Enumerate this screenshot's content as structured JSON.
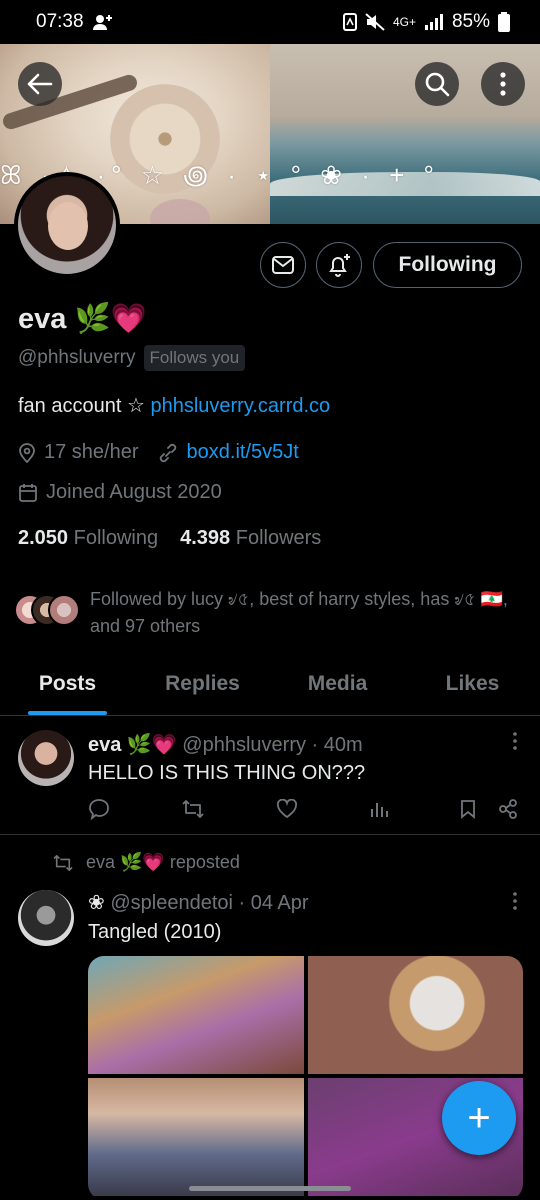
{
  "status_bar": {
    "time": "07:38",
    "network": "4G+",
    "battery": "85%"
  },
  "header": {
    "back_icon": "back-arrow-icon",
    "search_icon": "search-icon",
    "more_icon": "more-vertical-icon"
  },
  "banner": {
    "decoration": "ꕤ ·✧ ·° ☆ ꩜ · ⋆ ° ❀ · + °"
  },
  "profile": {
    "name": "eva 🌿💗",
    "handle": "@phhsluverry",
    "follows_you": "Follows you",
    "following_button": "Following",
    "bio_text": "fan account ☆ ",
    "bio_link": "phhsluverry.carrd.co",
    "location": "17 she/her",
    "website": "boxd.it/5v5Jt",
    "joined": "Joined August 2020",
    "following_count": "2.050",
    "following_label": "Following",
    "followers_count": "4.398",
    "followers_label": "Followers",
    "followed_by": "Followed by lucy ৶৫, best of harry styles, has ৶৫ 🇱🇧, and 97 others"
  },
  "tabs": [
    {
      "label": "Posts",
      "active": true
    },
    {
      "label": "Replies",
      "active": false
    },
    {
      "label": "Media",
      "active": false
    },
    {
      "label": "Likes",
      "active": false
    }
  ],
  "posts": [
    {
      "name": "eva 🌿💗",
      "handle": "@phhsluverry",
      "time": "· 40m",
      "text": "HELLO IS THIS THING ON???"
    },
    {
      "repost_label": "eva 🌿💗 reposted",
      "name": "❀",
      "handle": "@spleendetoi",
      "time": "· 04 Apr",
      "text": "Tangled (2010)"
    }
  ],
  "fab_label": "+"
}
